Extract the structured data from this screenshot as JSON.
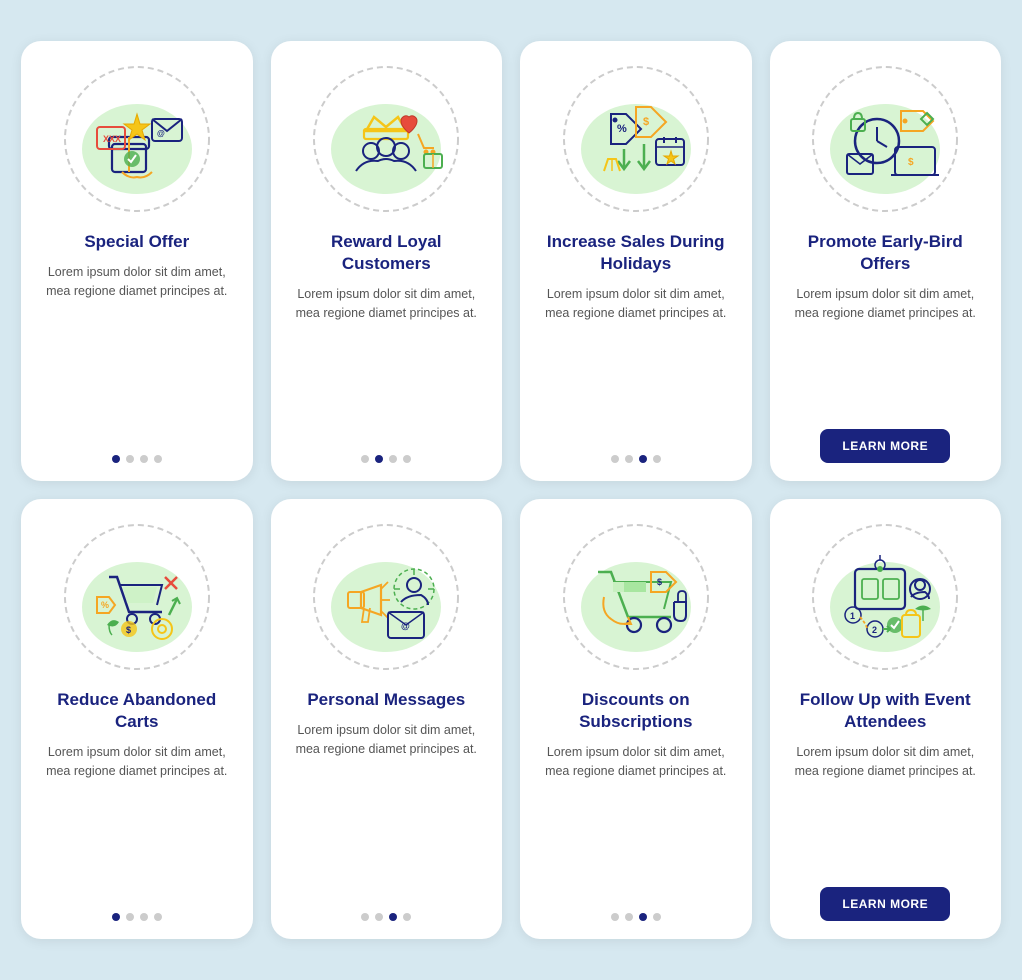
{
  "cards": [
    {
      "id": "special-offer",
      "title": "Special Offer",
      "body": "Lorem ipsum dolor sit dim amet, mea regione diamet principes at.",
      "dots": [
        true,
        false,
        false,
        false
      ],
      "has_button": false,
      "button_label": ""
    },
    {
      "id": "reward-loyal",
      "title": "Reward Loyal Customers",
      "body": "Lorem ipsum dolor sit dim amet, mea regione diamet principes at.",
      "dots": [
        false,
        true,
        false,
        false
      ],
      "has_button": false,
      "button_label": ""
    },
    {
      "id": "increase-sales",
      "title": "Increase Sales During Holidays",
      "body": "Lorem ipsum dolor sit dim amet, mea regione diamet principes at.",
      "dots": [
        false,
        false,
        true,
        false
      ],
      "has_button": false,
      "button_label": ""
    },
    {
      "id": "early-bird",
      "title": "Promote Early-Bird Offers",
      "body": "Lorem ipsum dolor sit dim amet, mea regione diamet principes at.",
      "dots": [],
      "has_button": true,
      "button_label": "LEARN MORE"
    },
    {
      "id": "abandoned-carts",
      "title": "Reduce Abandoned Carts",
      "body": "Lorem ipsum dolor sit dim amet, mea regione diamet principes at.",
      "dots": [
        true,
        false,
        false,
        false
      ],
      "has_button": false,
      "button_label": ""
    },
    {
      "id": "personal-messages",
      "title": "Personal Messages",
      "body": "Lorem ipsum dolor sit dim amet, mea regione diamet principes at.",
      "dots": [
        false,
        false,
        true,
        false
      ],
      "has_button": false,
      "button_label": ""
    },
    {
      "id": "discounts-subscriptions",
      "title": "Discounts on Subscriptions",
      "body": "Lorem ipsum dolor sit dim amet, mea regione diamet principes at.",
      "dots": [
        false,
        false,
        true,
        false
      ],
      "has_button": false,
      "button_label": ""
    },
    {
      "id": "follow-up",
      "title": "Follow Up with Event Attendees",
      "body": "Lorem ipsum dolor sit dim amet, mea regione diamet principes at.",
      "dots": [],
      "has_button": true,
      "button_label": "LEARN MORE"
    }
  ]
}
